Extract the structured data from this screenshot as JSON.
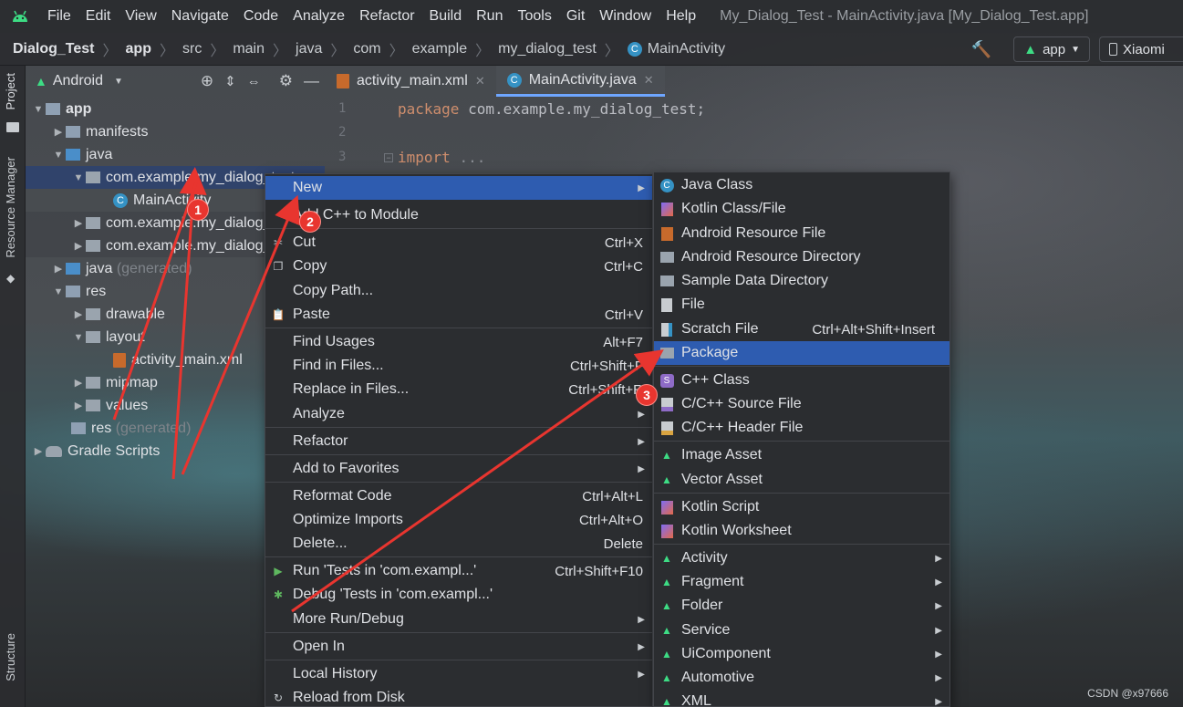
{
  "menubar": {
    "items": [
      "File",
      "Edit",
      "View",
      "Navigate",
      "Code",
      "Analyze",
      "Refactor",
      "Build",
      "Run",
      "Tools",
      "Git",
      "Window",
      "Help"
    ],
    "window_title": "My_Dialog_Test - MainActivity.java [My_Dialog_Test.app]"
  },
  "breadcrumb": {
    "items": [
      "Dialog_Test",
      "app",
      "src",
      "main",
      "java",
      "com",
      "example",
      "my_dialog_test",
      "MainActivity"
    ],
    "run_config": "app",
    "device": "Xiaomi"
  },
  "left_strip": {
    "tabs": [
      "Project",
      "Resource Manager",
      "Structure"
    ]
  },
  "project": {
    "view_mode": "Android",
    "tree": [
      {
        "label": "app",
        "indent": 0
      },
      {
        "label": "manifests",
        "indent": 1
      },
      {
        "label": "java",
        "indent": 1
      },
      {
        "label": "com.example.my_dialog_test",
        "indent": 2
      },
      {
        "label": "MainActivity",
        "indent": 3
      },
      {
        "label": "com.example.my_dialog_test",
        "indent": 2
      },
      {
        "label": "com.example.my_dialog_test",
        "indent": 2
      },
      {
        "label": "java",
        "suffix": "(generated)",
        "indent": 1
      },
      {
        "label": "res",
        "indent": 1
      },
      {
        "label": "drawable",
        "indent": 2
      },
      {
        "label": "layout",
        "indent": 2
      },
      {
        "label": "activity_main.xml",
        "indent": 3
      },
      {
        "label": "mipmap",
        "indent": 2
      },
      {
        "label": "values",
        "indent": 2
      },
      {
        "label": "res",
        "suffix": "(generated)",
        "indent": 1
      },
      {
        "label": "Gradle Scripts",
        "indent": 0
      }
    ]
  },
  "editor": {
    "tabs": [
      "activity_main.xml",
      "MainActivity.java"
    ],
    "line_numbers": [
      "1",
      "2",
      "3"
    ],
    "lines": [
      {
        "kw": "package",
        "rest": "com.example.my_dialog_test;"
      },
      {
        "kw": "",
        "rest": ""
      },
      {
        "kw": "import",
        "rest": "..."
      }
    ]
  },
  "context_menu": {
    "items": [
      {
        "label": "New",
        "shortcut": ""
      },
      {
        "label": "Add C++ to Module",
        "shortcut": ""
      },
      {
        "label": "Cut",
        "shortcut": "Ctrl+X"
      },
      {
        "label": "Copy",
        "shortcut": "Ctrl+C"
      },
      {
        "label": "Copy Path...",
        "shortcut": ""
      },
      {
        "label": "Paste",
        "shortcut": "Ctrl+V"
      },
      {
        "label": "Find Usages",
        "shortcut": "Alt+F7"
      },
      {
        "label": "Find in Files...",
        "shortcut": "Ctrl+Shift+F"
      },
      {
        "label": "Replace in Files...",
        "shortcut": "Ctrl+Shift+R"
      },
      {
        "label": "Analyze",
        "shortcut": ""
      },
      {
        "label": "Refactor",
        "shortcut": ""
      },
      {
        "label": "Add to Favorites",
        "shortcut": ""
      },
      {
        "label": "Reformat Code",
        "shortcut": "Ctrl+Alt+L"
      },
      {
        "label": "Optimize Imports",
        "shortcut": "Ctrl+Alt+O"
      },
      {
        "label": "Delete...",
        "shortcut": "Delete"
      },
      {
        "label": "Run 'Tests in 'com.exampl...'",
        "shortcut": "Ctrl+Shift+F10"
      },
      {
        "label": "Debug 'Tests in 'com.exampl...'",
        "shortcut": ""
      },
      {
        "label": "More Run/Debug",
        "shortcut": ""
      },
      {
        "label": "Open In",
        "shortcut": ""
      },
      {
        "label": "Local History",
        "shortcut": ""
      },
      {
        "label": "Reload from Disk",
        "shortcut": ""
      }
    ]
  },
  "submenu": {
    "items": [
      {
        "label": "Java Class",
        "shortcut": ""
      },
      {
        "label": "Kotlin Class/File",
        "shortcut": ""
      },
      {
        "label": "Android Resource File",
        "shortcut": ""
      },
      {
        "label": "Android Resource Directory",
        "shortcut": ""
      },
      {
        "label": "Sample Data Directory",
        "shortcut": ""
      },
      {
        "label": "File",
        "shortcut": ""
      },
      {
        "label": "Scratch File",
        "shortcut": "Ctrl+Alt+Shift+Insert"
      },
      {
        "label": "Package",
        "shortcut": ""
      },
      {
        "label": "C++ Class",
        "shortcut": ""
      },
      {
        "label": "C/C++ Source File",
        "shortcut": ""
      },
      {
        "label": "C/C++ Header File",
        "shortcut": ""
      },
      {
        "label": "Image Asset",
        "shortcut": ""
      },
      {
        "label": "Vector Asset",
        "shortcut": ""
      },
      {
        "label": "Kotlin Script",
        "shortcut": ""
      },
      {
        "label": "Kotlin Worksheet",
        "shortcut": ""
      },
      {
        "label": "Activity",
        "shortcut": ""
      },
      {
        "label": "Fragment",
        "shortcut": ""
      },
      {
        "label": "Folder",
        "shortcut": ""
      },
      {
        "label": "Service",
        "shortcut": ""
      },
      {
        "label": "UiComponent",
        "shortcut": ""
      },
      {
        "label": "Automotive",
        "shortcut": ""
      },
      {
        "label": "XML",
        "shortcut": ""
      }
    ]
  },
  "annotations": {
    "badges": [
      "1",
      "2",
      "3"
    ]
  },
  "watermark": "CSDN @x97666",
  "colors": {
    "accent": "#2e5cb0",
    "selection": "#2e436e",
    "annotation_red": "#e8352f",
    "android_green": "#3ddc84",
    "keyword": "#cf8e6d"
  }
}
